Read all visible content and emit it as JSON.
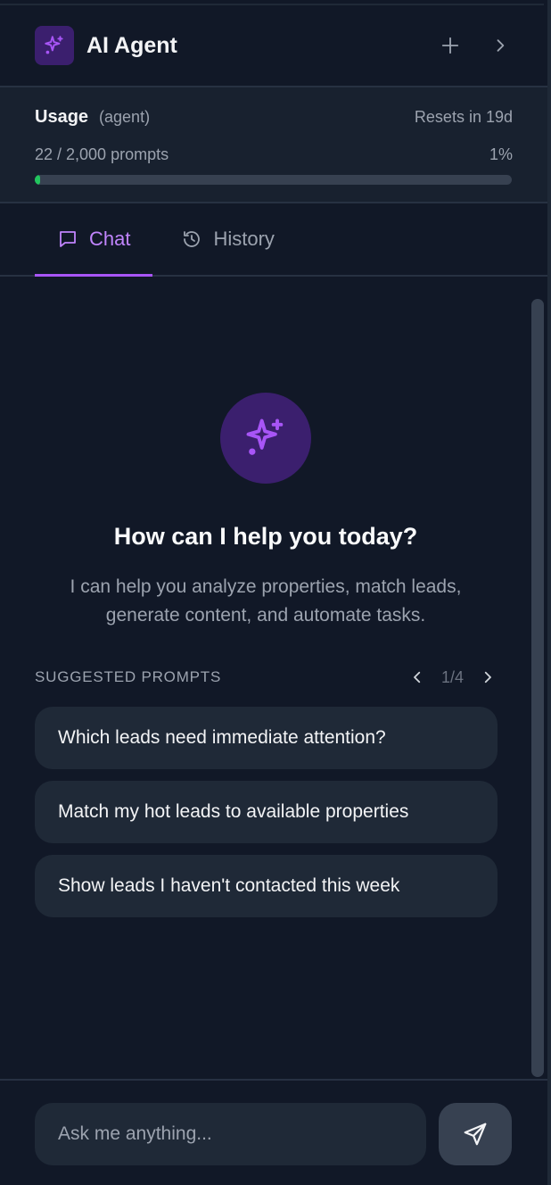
{
  "header": {
    "title": "AI Agent",
    "icons": {
      "logo": "sparkles-icon",
      "new_chat": "plus-icon",
      "collapse": "chevron-right-icon"
    }
  },
  "usage": {
    "title": "Usage",
    "scope": "(agent)",
    "reset": "Resets in 19d",
    "count": "22 / 2,000 prompts",
    "percent_label": "1%",
    "used_fraction": 0.011
  },
  "tabs": [
    {
      "label": "Chat",
      "icon": "message-square-icon",
      "active": true
    },
    {
      "label": "History",
      "icon": "history-icon",
      "active": false
    }
  ],
  "empty_state": {
    "title": "How can I help you today?",
    "description": "I can help you analyze properties, match leads, generate content, and automate tasks."
  },
  "suggestions": {
    "heading": "SUGGESTED PROMPTS",
    "pager": "1/4",
    "items": [
      "Which leads need immediate attention?",
      "Match my hot leads to available properties",
      "Show leads I haven't contacted this week"
    ]
  },
  "composer": {
    "placeholder": "Ask me anything...",
    "send_icon": "send-icon"
  },
  "colors": {
    "background": "#111827",
    "surface": "#1f2937",
    "accent": "#a855f7",
    "progress": "#22c55e"
  }
}
